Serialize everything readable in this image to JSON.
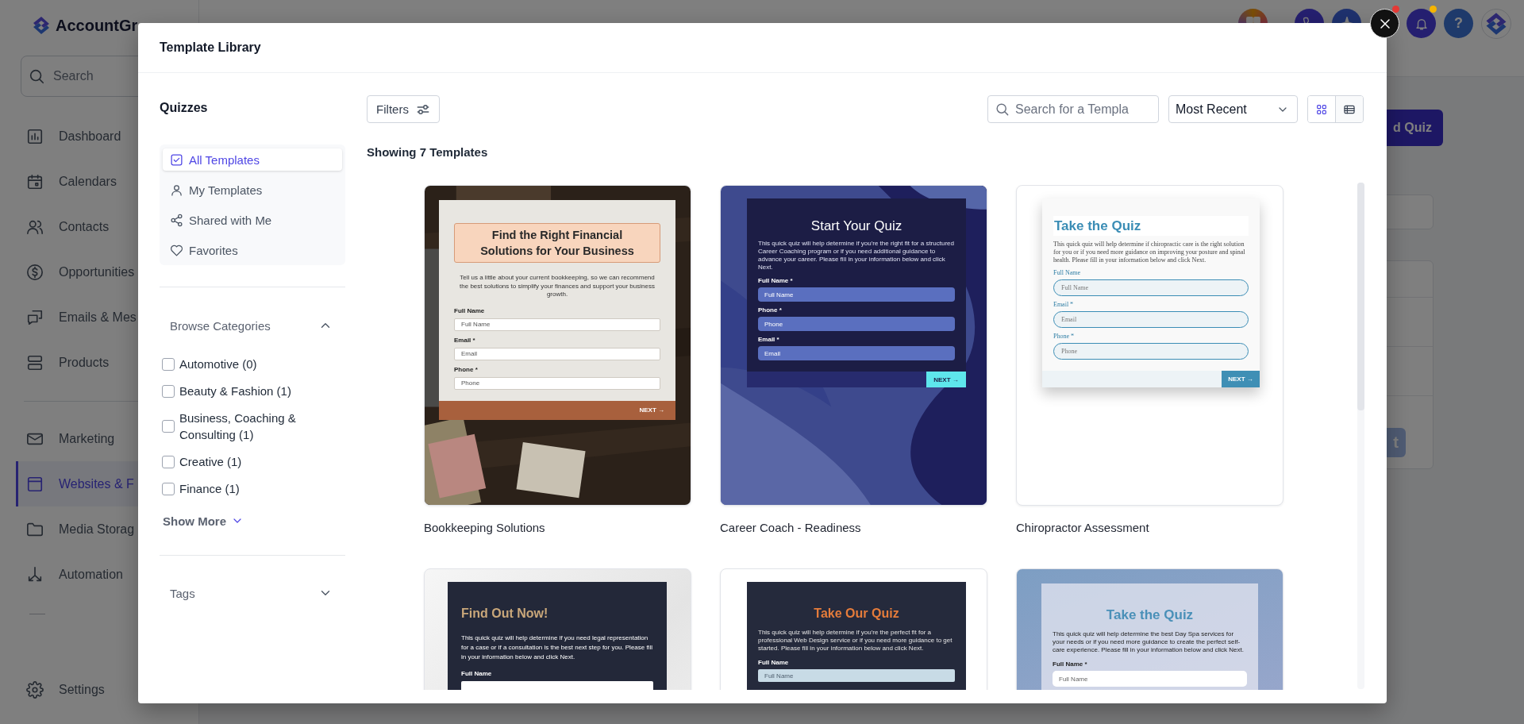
{
  "app": {
    "logo": "AccountGr",
    "search": {
      "placeholder": "Search"
    },
    "nav_sections": [
      {
        "items": [
          {
            "label": "Dashboard",
            "kind": "dashboard",
            "selected": false
          },
          {
            "label": "Calendars",
            "kind": "calendar",
            "selected": false
          },
          {
            "label": "Contacts",
            "kind": "contacts",
            "selected": false
          },
          {
            "label": "Opportunities",
            "kind": "opportunities",
            "selected": false
          },
          {
            "label": "Emails & Mes",
            "kind": "emails",
            "selected": false
          },
          {
            "label": "Products",
            "kind": "products",
            "selected": false
          }
        ]
      },
      {
        "items": [
          {
            "label": "Marketing",
            "kind": "marketing",
            "selected": false
          },
          {
            "label": "Websites & F",
            "kind": "websites",
            "selected": true
          },
          {
            "label": "Media Storag",
            "kind": "media",
            "selected": false
          },
          {
            "label": "Automation",
            "kind": "automation",
            "selected": false
          }
        ]
      }
    ],
    "footer_items": [
      {
        "label": "Settings",
        "kind": "settings",
        "selected": false
      }
    ],
    "header_icons": [
      {
        "kind": "apps"
      },
      {
        "kind": "phone"
      },
      {
        "kind": "sparkle"
      },
      {
        "kind": "avatar",
        "color": "#e53935"
      },
      {
        "kind": "bell",
        "color": "#f5b400"
      },
      {
        "kind": "help",
        "text": "?"
      },
      {
        "kind": "logo"
      }
    ],
    "main": {
      "primary_button": "d Quiz",
      "secondary_button": "t"
    }
  },
  "modal": {
    "title": "Template Library",
    "section_title": "Quizzes",
    "nav": [
      {
        "label": "All Templates",
        "kind": "check",
        "selected": true
      },
      {
        "label": "My Templates",
        "kind": "user",
        "selected": false
      },
      {
        "label": "Shared with Me",
        "kind": "share",
        "selected": false
      },
      {
        "label": "Favorites",
        "kind": "heart",
        "selected": false
      }
    ],
    "categories": {
      "heading": "Browse Categories",
      "expanded": true,
      "items": [
        {
          "label": "Automotive (0)",
          "checked": false
        },
        {
          "label": "Beauty & Fashion (1)",
          "checked": false
        },
        {
          "label": "Business, Coaching & Consulting (1)",
          "checked": false
        },
        {
          "label": "Creative (1)",
          "checked": false
        },
        {
          "label": "Finance (1)",
          "checked": false
        }
      ],
      "show_more": "Show More"
    },
    "tags": {
      "heading": "Tags",
      "expanded": false
    },
    "filters_button": "Filters",
    "search": {
      "placeholder": "Search for a Templa"
    },
    "sort": {
      "value": "Most Recent"
    },
    "views": [
      {
        "kind": "grid",
        "selected": true
      },
      {
        "kind": "list",
        "selected": false
      }
    ],
    "count": "Showing 7 Templates",
    "templates": [
      {
        "name": "Bookkeeping Solutions",
        "kind": "finance",
        "preview": {
          "title": "Find the Right Financial Solutions for Your Business",
          "description": "Tell us a little about your current bookkeeping, so we can recommend the best solutions to simplify your finances and support your business growth.",
          "fields": [
            {
              "label": "Full Name",
              "placeholder": "Full Name"
            },
            {
              "label": "Email *",
              "placeholder": "Email"
            },
            {
              "label": "Phone *",
              "placeholder": "Phone"
            }
          ],
          "next": "NEXT →"
        }
      },
      {
        "name": "Career Coach - Readiness",
        "kind": "career",
        "preview": {
          "title": "Start Your Quiz",
          "description": "This quick quiz will help determine if you're the right fit for a structured Career Coaching program or if you need additional guidance to advance your career. Please fill in your information below and click Next.",
          "fields": [
            {
              "label": "Full Name *",
              "placeholder": "Full Name"
            },
            {
              "label": "Phone *",
              "placeholder": "Phone"
            },
            {
              "label": "Email *",
              "placeholder": "Email"
            }
          ],
          "next": "NEXT →"
        }
      },
      {
        "name": "Chiropractor Assessment",
        "kind": "chiro",
        "preview": {
          "title": "Take the Quiz",
          "description": "This quick quiz will help determine if chiropractic care is the right solution for you or if you need more guidance on improving your posture and spinal health. Please fill in your information below and click Next.",
          "fields": [
            {
              "label": "Full Name",
              "placeholder": "Full Name"
            },
            {
              "label": "Email *",
              "placeholder": "Email"
            },
            {
              "label": "Phone *",
              "placeholder": "Phone"
            }
          ],
          "next": "NEXT →"
        }
      },
      {
        "kind": "legal",
        "preview": {
          "title": "Find Out Now!",
          "description": "This quick quiz will help determine if you need legal representation for a case or if a consultation is the best next step for you. Please fill in your information below and click Next.",
          "fields": [
            {
              "label": "Full Name"
            }
          ]
        }
      },
      {
        "kind": "webdesign",
        "preview": {
          "title": "Take Our Quiz",
          "description": "This quick quiz will help determine if you're the perfect fit for a professional Web Design service or if you need more guidance to get started. Please fill in your information below and click Next.",
          "fields": [
            {
              "label": "Full Name",
              "placeholder": "Full Name"
            }
          ]
        }
      },
      {
        "kind": "spa",
        "preview": {
          "title": "Take the Quiz",
          "description": "This quick quiz will help determine the best Day Spa services for your needs or if you need more guidance to create the perfect self-care experience. Please fill in your information below and click Next.",
          "fields": [
            {
              "label": "Full Name *",
              "placeholder": "Full Name"
            }
          ]
        }
      }
    ]
  }
}
